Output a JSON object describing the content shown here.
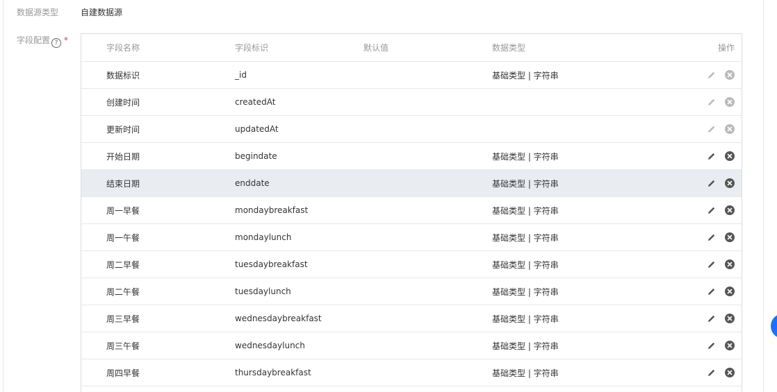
{
  "source_type": {
    "label": "数据源类型",
    "value": "自建数据源"
  },
  "field_config": {
    "label": "字段配置",
    "help": "?",
    "required": "*"
  },
  "table": {
    "headers": {
      "name": "字段名称",
      "key": "字段标识",
      "default": "默认值",
      "type": "数据类型",
      "ops": "操作"
    },
    "rows": [
      {
        "name": "数据标识",
        "key": "_id",
        "default": "",
        "type": "基础类型 | 字符串",
        "editable": false
      },
      {
        "name": "创建时间",
        "key": "createdAt",
        "default": "",
        "type": "",
        "editable": false
      },
      {
        "name": "更新时间",
        "key": "updatedAt",
        "default": "",
        "type": "",
        "editable": false
      },
      {
        "name": "开始日期",
        "key": "begindate",
        "default": "",
        "type": "基础类型 | 字符串",
        "editable": true
      },
      {
        "name": "结束日期",
        "key": "enddate",
        "default": "",
        "type": "基础类型 | 字符串",
        "editable": true,
        "highlight": true
      },
      {
        "name": "周一早餐",
        "key": "mondaybreakfast",
        "default": "",
        "type": "基础类型 | 字符串",
        "editable": true
      },
      {
        "name": "周一午餐",
        "key": "mondaylunch",
        "default": "",
        "type": "基础类型 | 字符串",
        "editable": true
      },
      {
        "name": "周二早餐",
        "key": "tuesdaybreakfast",
        "default": "",
        "type": "基础类型 | 字符串",
        "editable": true
      },
      {
        "name": "周二午餐",
        "key": "tuesdaylunch",
        "default": "",
        "type": "基础类型 | 字符串",
        "editable": true
      },
      {
        "name": "周三早餐",
        "key": "wednesdaybreakfast",
        "default": "",
        "type": "基础类型 | 字符串",
        "editable": true
      },
      {
        "name": "周三午餐",
        "key": "wednesdaylunch",
        "default": "",
        "type": "基础类型 | 字符串",
        "editable": true
      },
      {
        "name": "周四早餐",
        "key": "thursdaybreakfast",
        "default": "",
        "type": "基础类型 | 字符串",
        "editable": true
      }
    ]
  },
  "icons": {
    "edit": "pencil-icon",
    "delete": "close-circle-icon",
    "help": "question-circle-icon"
  },
  "colors": {
    "accent": "#1e6fff",
    "highlight_row": "#e9edf2",
    "required": "#e53935"
  }
}
